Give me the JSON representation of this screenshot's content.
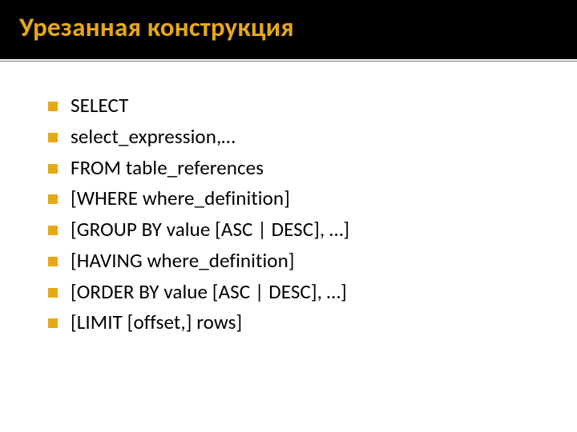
{
  "title": "Урезанная конструкция",
  "bullets": [
    "SELECT",
    "select_expression,…",
    "FROM table_references",
    "[WHERE where_definition]",
    "[GROUP BY value [ASC | DESC], …]",
    "[HAVING where_definition]",
    "[ORDER BY value [ASC | DESC], …]",
    "[LIMIT [offset,] rows]"
  ]
}
